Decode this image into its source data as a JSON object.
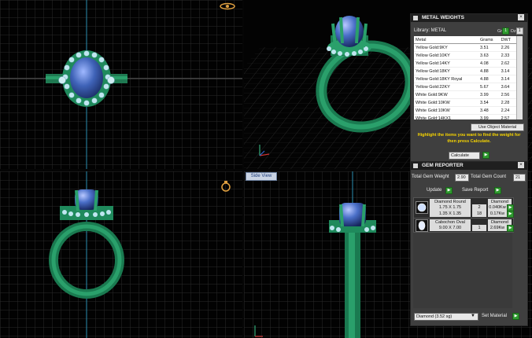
{
  "viewports": {
    "side_view_label": "Side View"
  },
  "metal_weights": {
    "title": "METAL WEIGHTS",
    "library_label": "Library: METAL",
    "toggle_gr": "Gr",
    "toggle_oz": "Oz",
    "columns": [
      "Metal",
      "Grams",
      "DWT"
    ],
    "rows": [
      [
        "Yellow Gold:9KY",
        "3.51",
        "2.26"
      ],
      [
        "Yellow Gold:10KY",
        "3.63",
        "2.33"
      ],
      [
        "Yellow Gold:14KY",
        "4.08",
        "2.62"
      ],
      [
        "Yellow Gold:18KY",
        "4.88",
        "3.14"
      ],
      [
        "Yellow Gold:18KY Royal",
        "4.88",
        "3.14"
      ],
      [
        "Yellow Gold:22KY",
        "5.67",
        "3.64"
      ],
      [
        "White Gold:9KW",
        "3.99",
        "2.56"
      ],
      [
        "White Gold:10KW",
        "3.54",
        "2.28"
      ],
      [
        "White Gold:10KW",
        "3.48",
        "2.24"
      ],
      [
        "White Gold:14KX1",
        "3.99",
        "2.57"
      ],
      [
        "White Gold:14K PdW",
        "4.56",
        "2.93"
      ]
    ],
    "use_object_material": "Use Object Material",
    "hint": "Highlight the items you want to find the weight for then press Calculate.",
    "calculate_label": "Calculate"
  },
  "gem_reporter": {
    "title": "GEM REPORTER",
    "total_gem_weight_label": "Total Gem Weight",
    "total_gem_weight": "2.90",
    "total_gem_count_label": "Total Gem Count",
    "total_gem_count": "21",
    "update_label": "Update",
    "save_report_label": "Save Report",
    "gems": [
      {
        "icon": "diamond-round-icon",
        "name": "Diamond Round",
        "material": "Diamond",
        "sizes": [
          {
            "size": "1.75 X 1.75",
            "count": "2",
            "weight": "0.040Kw"
          },
          {
            "size": "1.35 X 1.35",
            "count": "18",
            "weight": "0.17Kw"
          }
        ]
      },
      {
        "icon": "cabochon-oval-icon",
        "name": "Cabochon Oval",
        "material": "Diamond",
        "sizes": [
          {
            "size": "9.00 X 7.00",
            "count": "1",
            "weight": "2.69Kw"
          }
        ]
      }
    ],
    "material_select": "Diamond   (3.52 sg)",
    "set_material_label": "Set Material"
  },
  "colors": {
    "ring_green": "#1f8a5c",
    "gem_blue": "#3f63b8",
    "accent_green": "#2f9a2f",
    "hint_yellow": "#f6d400"
  }
}
